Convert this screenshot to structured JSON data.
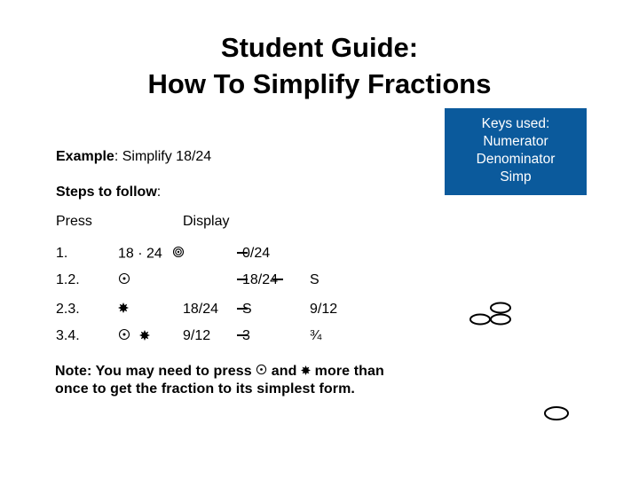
{
  "title": {
    "line1": "Student Guide:",
    "line2": "How To Simplify Fractions"
  },
  "keys_box": {
    "heading": "Keys used:",
    "items": [
      "Numerator",
      "Denominator",
      "Simp"
    ],
    "background_color": "#0b5a9c"
  },
  "example": {
    "label": "Example",
    "colon": ":",
    "text": " Simplify 18/24"
  },
  "steps": {
    "label": "Steps to follow",
    "colon": ":"
  },
  "table_headers": {
    "press": "Press",
    "display": "Display"
  },
  "rows": [
    {
      "step": "1.",
      "press_text": "18 · 24",
      "press_icons": [
        "numerator-key-icon"
      ],
      "display_before": "",
      "display": "0/24",
      "result": ""
    },
    {
      "step": "1.2.",
      "press_text": "",
      "press_icons": [
        "simp-key-icon"
      ],
      "display_before": "",
      "display": "18/24",
      "result": "S"
    },
    {
      "step": "2.3.",
      "press_text": "",
      "press_icons": [
        "denominator-key-icon"
      ],
      "display_before": "18/24",
      "display": "S",
      "result": "9/12"
    },
    {
      "step": "3.4.",
      "press_text": "",
      "press_icons": [
        "simp-key-icon",
        "denominator-key-icon"
      ],
      "display_before": "9/12",
      "display": "3",
      "result": "¾"
    }
  ],
  "note": {
    "part1": "Note: You may need to press ",
    "part2": " and ",
    "part3": " more than",
    "line2": "once to get the fraction to its simplest form."
  }
}
